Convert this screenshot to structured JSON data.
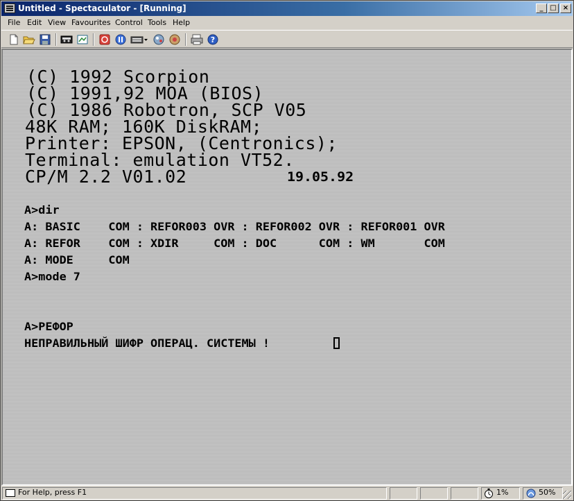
{
  "window": {
    "title": "Untitled - Spectaculator - [Running]",
    "buttons": {
      "minimize": "_",
      "maximize": "□",
      "close": "×"
    }
  },
  "menu": [
    "File",
    "Edit",
    "View",
    "Favourites",
    "Control",
    "Tools",
    "Help"
  ],
  "toolbar": {
    "icons": [
      "new-file-icon",
      "open-folder-icon",
      "save-icon",
      "tape-icon",
      "snapshot-icon",
      "reset-icon",
      "pause-icon",
      "keyboard-icon",
      "joystick-icon",
      "sound-icon",
      "printer-icon",
      "help-icon"
    ]
  },
  "screen": {
    "banner": [
      "(C) 1992 Scorpion",
      "(C) 1991,92 MOA (BIOS)",
      "(C) 1986 Robotron, SCP V05",
      "48K RAM; 160K DiskRAM;",
      "Printer: EPSON, (Centronics);",
      "Terminal: emulation VT52."
    ],
    "cpm_title": "CP/M 2.2 V01.02",
    "cpm_date": "19.05.92",
    "console": [
      "A>dir",
      "A: BASIC    COM : REFOR003 OVR : REFOR002 OVR : REFOR001 OVR",
      "A: REFOR    COM : XDIR     COM : DOC      COM : WM       COM",
      "A: MODE     COM",
      "A>mode 7",
      "A>РЕФОР",
      "НЕПРАВИЛЬНЫЙ ШИФР ОПЕРАЦ. СИСТЕМЫ !"
    ]
  },
  "status": {
    "help_text": "For Help, press F1",
    "cpu_load": "1%",
    "speed": "50%"
  },
  "colors": {
    "titlebar_start": "#0a246a",
    "titlebar_end": "#a6caf0",
    "screen_bg": "#c4c4c4",
    "screen_ink": "#000000"
  }
}
